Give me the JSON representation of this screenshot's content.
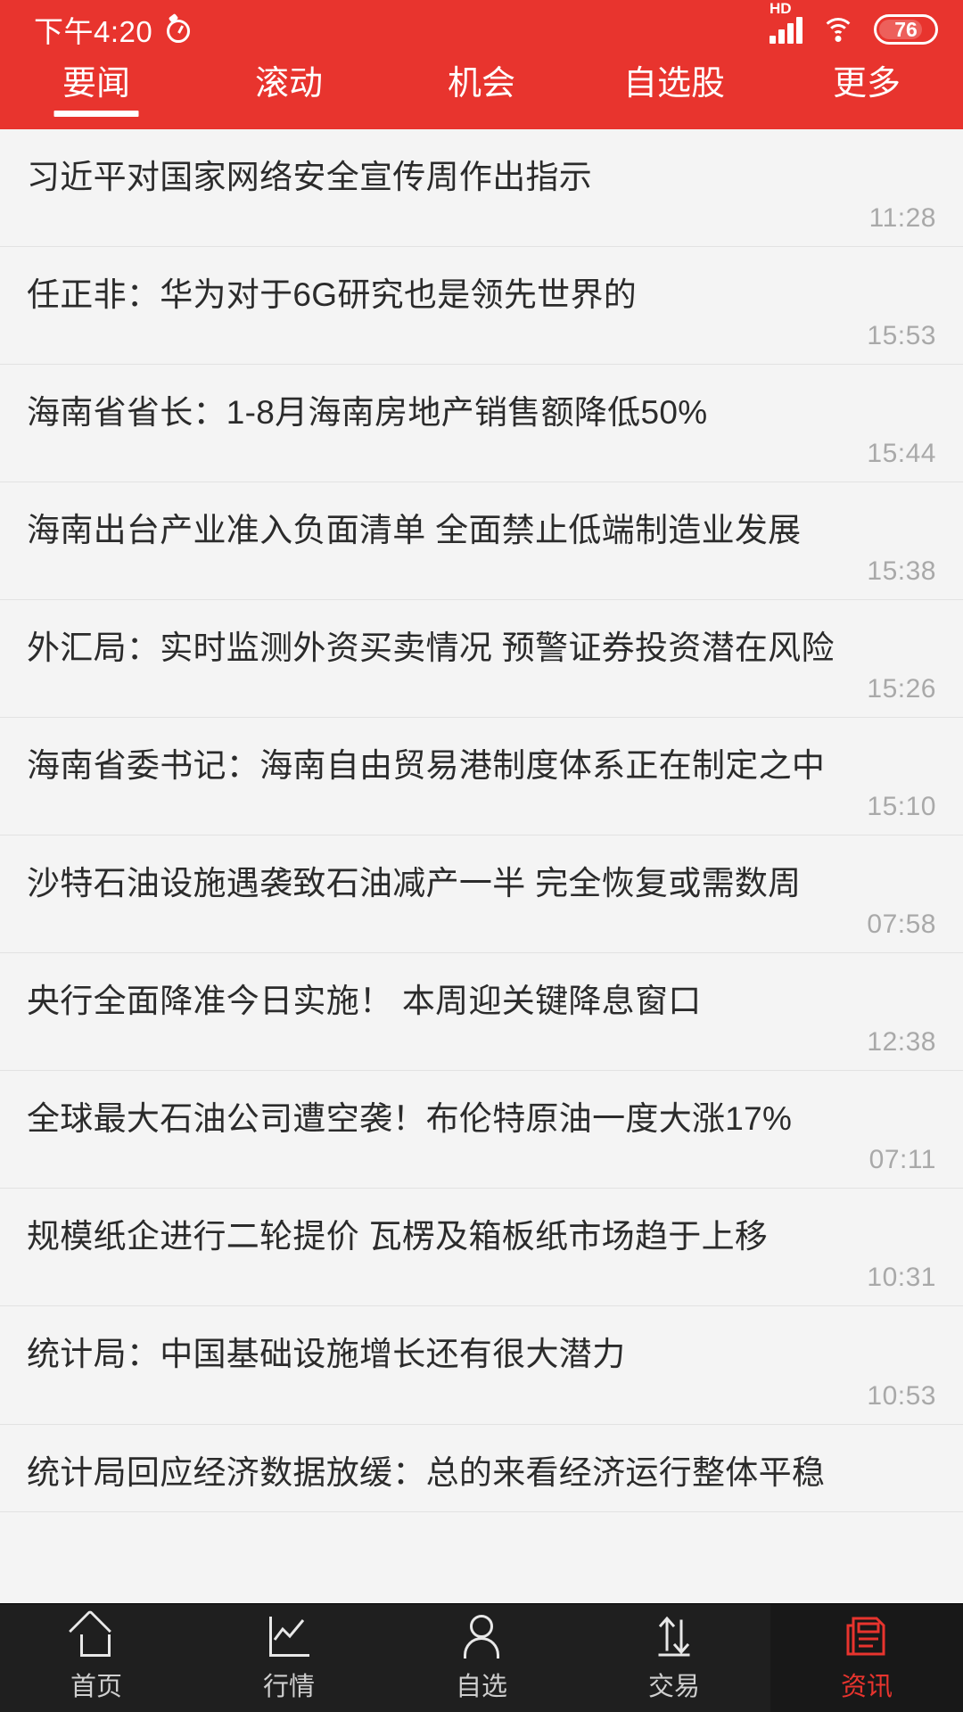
{
  "statusbar": {
    "time": "下午4:20",
    "alarm_icon": "alarm-clock-icon",
    "network_label": "HD",
    "signal_icon": "signal-bars-icon",
    "wifi_icon": "wifi-icon",
    "battery_level": "76"
  },
  "topnav": {
    "active_index": 0,
    "tabs": [
      {
        "label": "要闻"
      },
      {
        "label": "滚动"
      },
      {
        "label": "机会"
      },
      {
        "label": "自选股"
      },
      {
        "label": "更多"
      }
    ]
  },
  "news": {
    "items": [
      {
        "title": "习近平对国家网络安全宣传周作出指示",
        "time": "11:28"
      },
      {
        "title": "任正非：华为对于6G研究也是领先世界的",
        "time": "15:53"
      },
      {
        "title": "海南省省长：1-8月海南房地产销售额降低50%",
        "time": "15:44"
      },
      {
        "title": "海南出台产业准入负面清单 全面禁止低端制造业发展",
        "time": "15:38"
      },
      {
        "title": "外汇局：实时监测外资买卖情况 预警证券投资潜在风险",
        "time": "15:26"
      },
      {
        "title": "海南省委书记：海南自由贸易港制度体系正在制定之中",
        "time": "15:10"
      },
      {
        "title": "沙特石油设施遇袭致石油减产一半 完全恢复或需数周",
        "time": "07:58"
      },
      {
        "title": "央行全面降准今日实施！ 本周迎关键降息窗口",
        "time": "12:38"
      },
      {
        "title": "全球最大石油公司遭空袭！布伦特原油一度大涨17%",
        "time": "07:11"
      },
      {
        "title": "规模纸企进行二轮提价 瓦楞及箱板纸市场趋于上移",
        "time": "10:31"
      },
      {
        "title": "统计局：中国基础设施增长还有很大潜力",
        "time": "10:53"
      },
      {
        "title": "统计局回应经济数据放缓：总的来看经济运行整体平稳",
        "time": ""
      }
    ]
  },
  "bottomnav": {
    "active_index": 4,
    "items": [
      {
        "label": "首页",
        "icon": "home-icon"
      },
      {
        "label": "行情",
        "icon": "line-chart-icon"
      },
      {
        "label": "自选",
        "icon": "person-icon"
      },
      {
        "label": "交易",
        "icon": "trade-arrows-icon"
      },
      {
        "label": "资讯",
        "icon": "news-document-icon"
      }
    ]
  },
  "colors": {
    "brand_red": "#e8342e",
    "list_bg": "#f4f4f4",
    "bottom_bg": "#1f1f1f"
  }
}
